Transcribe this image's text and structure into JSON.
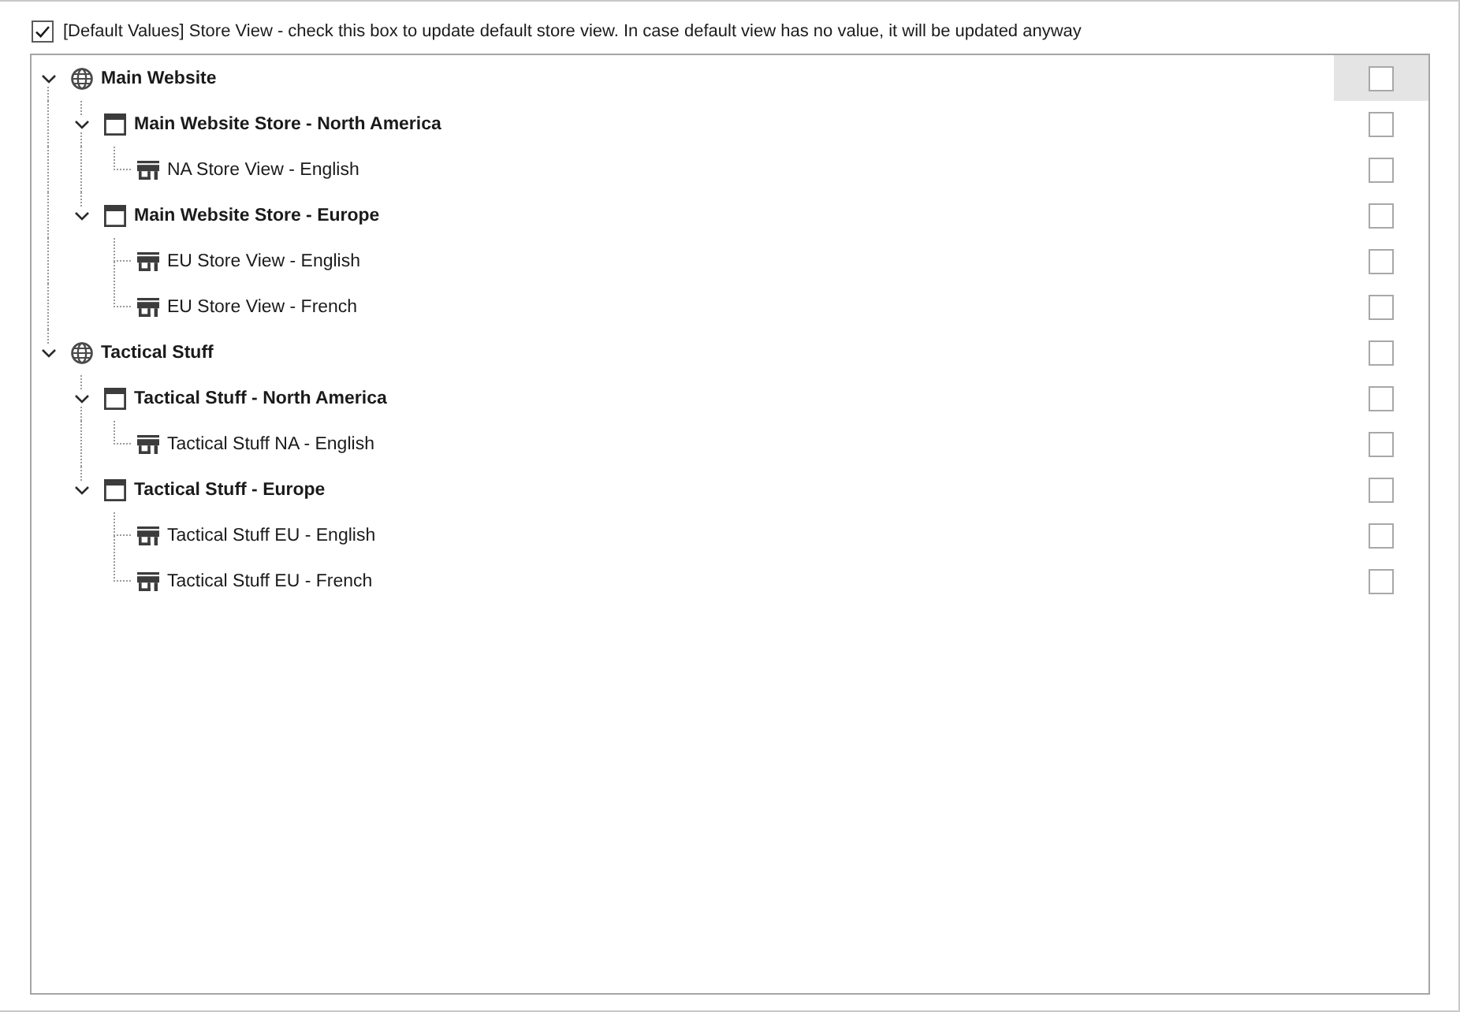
{
  "default_values": {
    "checked": true,
    "label": "[Default Values] Store View - check this box to update default store view. In case default view has no value, it will be updated anyway"
  },
  "tree": [
    {
      "kind": "website",
      "label": "Main Website",
      "expanded": true,
      "checked": false,
      "highlighted": true,
      "children": [
        {
          "kind": "store",
          "label": "Main Website Store - North America",
          "expanded": true,
          "checked": false,
          "highlighted": false,
          "children": [
            {
              "kind": "store_view",
              "label": "NA Store View - English",
              "checked": false,
              "highlighted": false
            }
          ]
        },
        {
          "kind": "store",
          "label": "Main Website Store - Europe",
          "expanded": true,
          "checked": false,
          "highlighted": false,
          "children": [
            {
              "kind": "store_view",
              "label": "EU Store View - English",
              "checked": false,
              "highlighted": false
            },
            {
              "kind": "store_view",
              "label": "EU Store View - French",
              "checked": false,
              "highlighted": false
            }
          ]
        }
      ]
    },
    {
      "kind": "website",
      "label": "Tactical Stuff",
      "expanded": true,
      "checked": false,
      "highlighted": false,
      "children": [
        {
          "kind": "store",
          "label": "Tactical Stuff - North America",
          "expanded": true,
          "checked": false,
          "highlighted": false,
          "children": [
            {
              "kind": "store_view",
              "label": "Tactical Stuff NA - English",
              "checked": false,
              "highlighted": false
            }
          ]
        },
        {
          "kind": "store",
          "label": "Tactical Stuff - Europe",
          "expanded": true,
          "checked": false,
          "highlighted": false,
          "children": [
            {
              "kind": "store_view",
              "label": "Tactical Stuff EU - English",
              "checked": false,
              "highlighted": false
            },
            {
              "kind": "store_view",
              "label": "Tactical Stuff EU - French",
              "checked": false,
              "highlighted": false
            }
          ]
        }
      ]
    }
  ]
}
